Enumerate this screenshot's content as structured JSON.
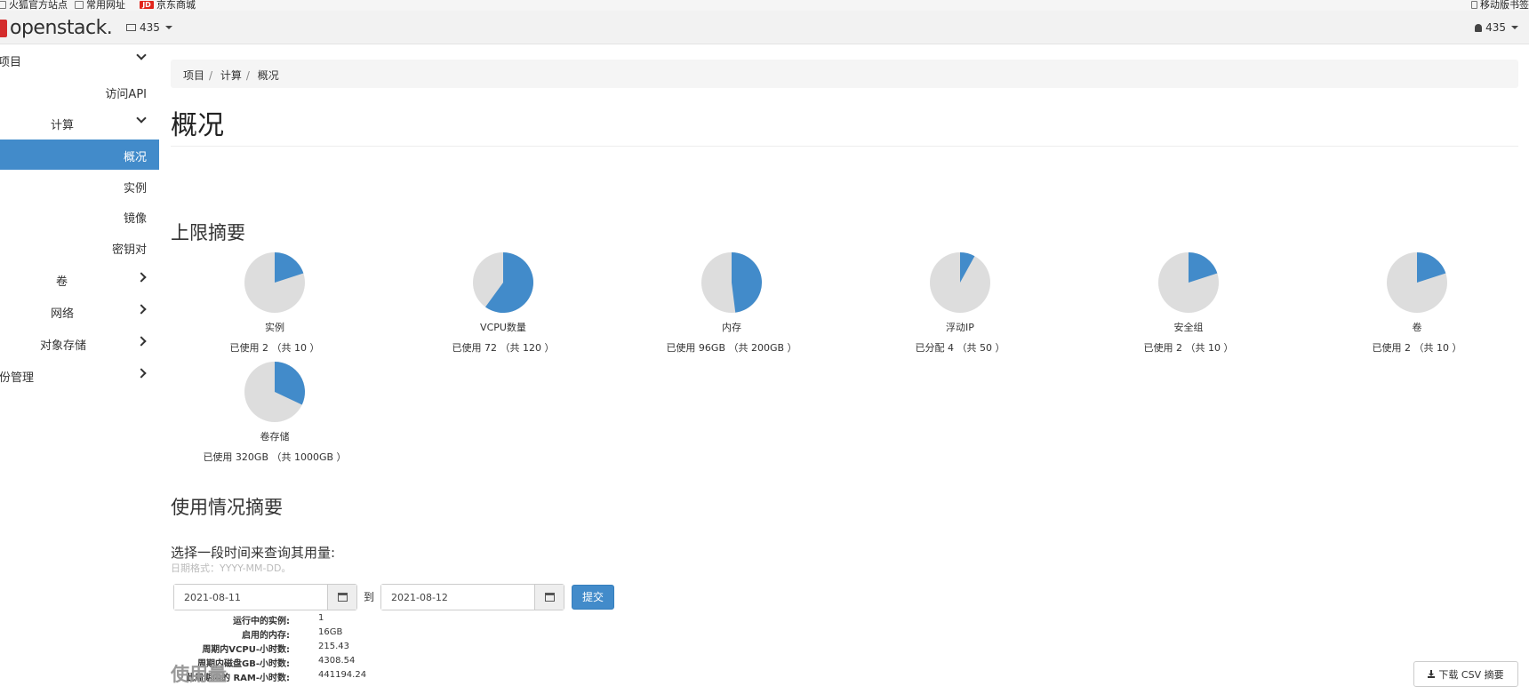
{
  "bookmarks": [
    {
      "label": "火狐官方站点",
      "icon": "page-icon"
    },
    {
      "label": "常用网址",
      "icon": "page-icon"
    },
    {
      "label": "京东商城",
      "icon": "jd-icon"
    }
  ],
  "bookmarks_right": "移动版书签",
  "jd_badge": "JD",
  "navbar": {
    "logo": "openstack.",
    "project_dropdown": "435",
    "user_dropdown": "435"
  },
  "sidebar": {
    "project": "项目",
    "api_access": "访问API",
    "compute": "计算",
    "overview": "概况",
    "instances": "实例",
    "images": "镜像",
    "keypairs": "密钥对",
    "volumes": "卷",
    "network": "网络",
    "object_storage": "对象存储",
    "identity": "身份管理"
  },
  "breadcrumb": [
    "项目",
    "计算",
    "概况"
  ],
  "page_title": "概况",
  "limits": {
    "heading": "上限摘要",
    "items": [
      {
        "name": "实例",
        "sub": "已使用 2 （共 10 ）",
        "used": 2,
        "total": 10
      },
      {
        "name": "VCPU数量",
        "sub": "已使用 72 （共 120 ）",
        "used": 72,
        "total": 120
      },
      {
        "name": "内存",
        "sub": "已使用 96GB （共 200GB ）",
        "used": 96,
        "total": 200
      },
      {
        "name": "浮动IP",
        "sub": "已分配 4 （共 50 ）",
        "used": 4,
        "total": 50
      },
      {
        "name": "安全组",
        "sub": "已使用 2 （共 10 ）",
        "used": 2,
        "total": 10
      },
      {
        "name": "卷",
        "sub": "已使用 2 （共 10 ）",
        "used": 2,
        "total": 10
      },
      {
        "name": "卷存储",
        "sub": "已使用 320GB （共 1000GB ）",
        "used": 320,
        "total": 1000
      }
    ],
    "colors": {
      "used": "#428bca",
      "free": "#dddddd"
    }
  },
  "usage_summary": {
    "heading": "使用情况摘要",
    "query_label": "选择一段时间来查询其用量:",
    "date_hint": "日期格式：YYYY-MM-DD。",
    "start_date": "2021-08-11",
    "to_label": "到",
    "end_date": "2021-08-12",
    "submit": "提交",
    "stats": [
      {
        "k": "运行中的实例:",
        "v": "1"
      },
      {
        "k": "启用的内存:",
        "v": "16GB"
      },
      {
        "k": "周期内VCPU-小时数:",
        "v": "215.43"
      },
      {
        "k": "周期内磁盘GB-小时数:",
        "v": "4308.54"
      },
      {
        "k": "此周期内的 RAM-小时数:",
        "v": "441194.24"
      }
    ]
  },
  "usage": {
    "heading": "使用量",
    "csv_button": "下载 CSV 摘要"
  }
}
